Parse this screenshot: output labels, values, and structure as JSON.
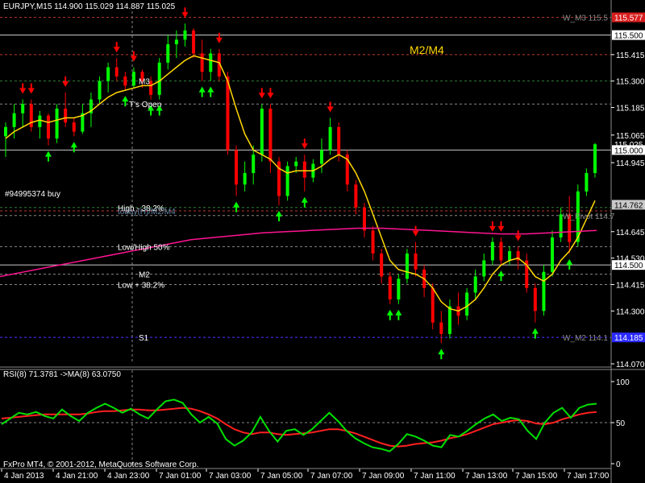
{
  "main_header": "EURJPY,M15  114.900 115.029 114.887 115.025",
  "rsi_header": "RSI(8) 71.3781  ->MA(8) 63.0750",
  "footer": "FxPro MT4, © 2001-2012, MetaQuotes Software Corp.",
  "center_label": "M2/M4",
  "colors": {
    "background": "#000000",
    "bull_candle": "#00ff00",
    "bear_candle": "#ff0000",
    "ma_line": "#ffd700",
    "long_ma_line": "#ff1493",
    "rsi_line": "#00e000",
    "rsi_ma_line": "#ff2020",
    "axis_text": "#ffffff",
    "level_dashed": "#c0392b",
    "level_solid": "#c8c8c8",
    "blue_level": "#2a2aff"
  },
  "price_axis": {
    "ylim": [
      114.07,
      115.6
    ],
    "ticks": [
      "115.415",
      "115.300",
      "115.185",
      "115.065",
      "114.945",
      "114.645",
      "114.530",
      "114.415",
      "114.300",
      "114.070"
    ]
  },
  "price_tags": [
    {
      "value": 115.577,
      "text": "115.577",
      "style": "red"
    },
    {
      "value": 115.5,
      "text": "115.500",
      "style": "white"
    },
    {
      "value": 115.025,
      "text": "115.025",
      "style": "plain"
    },
    {
      "value": 115.0,
      "text": "115.000",
      "style": "white"
    },
    {
      "value": 114.762,
      "text": "114.762",
      "style": "gray"
    },
    {
      "value": 114.5,
      "text": "114.500",
      "style": "white"
    },
    {
      "value": 114.185,
      "text": "114.185",
      "style": "blue"
    }
  ],
  "levels": [
    {
      "value": 115.577,
      "style": "dashed-red",
      "label": "W_M3 115.5",
      "label_side": "right"
    },
    {
      "value": 115.5,
      "style": "solid-gray",
      "label": "",
      "label_side": "right"
    },
    {
      "value": 115.415,
      "style": "dashed-red",
      "label": "",
      "label_side": "right"
    },
    {
      "value": 115.3,
      "style": "dashed-green",
      "label": "M3",
      "label_side": "left"
    },
    {
      "value": 115.2,
      "style": "dashed-gray",
      "label": "T's Open",
      "label_side": "left"
    },
    {
      "value": 115.0,
      "style": "solid-gray",
      "label": "",
      "label_side": "right"
    },
    {
      "value": 114.75,
      "style": "dashed-green",
      "label": "High - 38.2%",
      "label_side": "left"
    },
    {
      "value": 114.735,
      "style": "dashed-red",
      "label": "today(H)/M2/M4",
      "label_side": "left"
    },
    {
      "value": 114.715,
      "style": "dashed-gray",
      "label": "W_Pivot 114.7",
      "label_side": "right"
    },
    {
      "value": 114.58,
      "style": "dashed-gray",
      "label": "Low/High 50%",
      "label_side": "left"
    },
    {
      "value": 114.5,
      "style": "solid-gray",
      "label": "",
      "label_side": "right"
    },
    {
      "value": 114.46,
      "style": "dashed-gray",
      "label": "M2",
      "label_side": "left"
    },
    {
      "value": 114.415,
      "style": "dashed-gray",
      "label": "Low + 38.2%",
      "label_side": "left"
    },
    {
      "value": 114.185,
      "style": "dashed-red",
      "label": "S1",
      "label_side": "left"
    },
    {
      "value": 114.185,
      "style": "dashed-blue",
      "label": "W_M2 114.1",
      "label_side": "right"
    }
  ],
  "trade_label": "#94995374 buy",
  "x_axis_labels": [
    "4 Jan 2013",
    "4 Jan 21:00",
    "4 Jan 23:00",
    "7 Jan 01:00",
    "7 Jan 03:00",
    "7 Jan 05:00",
    "7 Jan 07:00",
    "7 Jan 09:00",
    "7 Jan 11:00",
    "7 Jan 13:00",
    "7 Jan 15:00",
    "7 Jan 17:00"
  ],
  "rsi_axis": {
    "ylim": [
      0,
      100
    ],
    "ticks": [
      "100",
      "50",
      "0"
    ],
    "level": 50
  },
  "chart_data": [
    {
      "type": "candlestick",
      "title": "EURJPY,M15",
      "series": [
        {
          "name": "EURJPY",
          "candles": [
            [
              115.06,
              115.12,
              114.97,
              115.1
            ],
            [
              115.1,
              115.2,
              115.05,
              115.16
            ],
            [
              115.16,
              115.22,
              115.1,
              115.2
            ],
            [
              115.2,
              115.22,
              115.08,
              115.1
            ],
            [
              115.1,
              115.17,
              115.05,
              115.15
            ],
            [
              115.15,
              115.16,
              115.02,
              115.05
            ],
            [
              115.05,
              115.2,
              115.03,
              115.18
            ],
            [
              115.18,
              115.25,
              115.1,
              115.12
            ],
            [
              115.12,
              115.14,
              115.06,
              115.08
            ],
            [
              115.08,
              115.2,
              115.07,
              115.16
            ],
            [
              115.16,
              115.25,
              115.1,
              115.22
            ],
            [
              115.22,
              115.32,
              115.2,
              115.3
            ],
            [
              115.3,
              115.38,
              115.25,
              115.36
            ],
            [
              115.36,
              115.4,
              115.3,
              115.32
            ],
            [
              115.32,
              115.34,
              115.26,
              115.28
            ],
            [
              115.28,
              115.36,
              115.27,
              115.34
            ],
            [
              115.34,
              115.35,
              115.27,
              115.3
            ],
            [
              115.3,
              115.32,
              115.22,
              115.24
            ],
            [
              115.24,
              115.4,
              115.22,
              115.38
            ],
            [
              115.38,
              115.5,
              115.35,
              115.46
            ],
            [
              115.46,
              115.52,
              115.4,
              115.48
            ],
            [
              115.48,
              115.55,
              115.45,
              115.52
            ],
            [
              115.52,
              115.53,
              115.4,
              115.42
            ],
            [
              115.42,
              115.48,
              115.3,
              115.34
            ],
            [
              115.34,
              115.44,
              115.3,
              115.42
            ],
            [
              115.42,
              115.44,
              115.3,
              115.32
            ],
            [
              115.32,
              115.34,
              114.98,
              115.0
            ],
            [
              115.0,
              115.02,
              114.8,
              114.85
            ],
            [
              114.85,
              114.95,
              114.82,
              114.9
            ],
            [
              114.9,
              115.02,
              114.85,
              114.98
            ],
            [
              114.98,
              115.2,
              114.95,
              115.18
            ],
            [
              115.18,
              115.2,
              114.9,
              114.95
            ],
            [
              114.95,
              114.97,
              114.76,
              114.8
            ],
            [
              114.8,
              114.95,
              114.78,
              114.93
            ],
            [
              114.93,
              114.97,
              114.9,
              114.95
            ],
            [
              114.95,
              114.98,
              114.82,
              114.88
            ],
            [
              114.88,
              114.96,
              114.86,
              114.94
            ],
            [
              114.94,
              115.05,
              114.9,
              115.0
            ],
            [
              115.0,
              115.14,
              114.98,
              115.1
            ],
            [
              115.1,
              115.12,
              114.95,
              114.98
            ],
            [
              114.98,
              115.0,
              114.82,
              114.85
            ],
            [
              114.85,
              114.87,
              114.72,
              114.75
            ],
            [
              114.75,
              114.77,
              114.62,
              114.65
            ],
            [
              114.65,
              114.67,
              114.52,
              114.55
            ],
            [
              114.55,
              114.57,
              114.42,
              114.45
            ],
            [
              114.45,
              114.47,
              114.33,
              114.35
            ],
            [
              114.35,
              114.46,
              114.33,
              114.44
            ],
            [
              114.44,
              114.57,
              114.42,
              114.55
            ],
            [
              114.55,
              114.6,
              114.45,
              114.48
            ],
            [
              114.48,
              114.5,
              114.36,
              114.4
            ],
            [
              114.4,
              114.42,
              114.22,
              114.25
            ],
            [
              114.25,
              114.3,
              114.16,
              114.2
            ],
            [
              114.2,
              114.35,
              114.18,
              114.32
            ],
            [
              114.32,
              114.38,
              114.24,
              114.28
            ],
            [
              114.28,
              114.4,
              114.26,
              114.38
            ],
            [
              114.38,
              114.48,
              114.35,
              114.45
            ],
            [
              114.45,
              114.55,
              114.43,
              114.52
            ],
            [
              114.52,
              114.62,
              114.5,
              114.6
            ],
            [
              114.6,
              114.62,
              114.5,
              114.52
            ],
            [
              114.52,
              114.58,
              114.5,
              114.56
            ],
            [
              114.56,
              114.58,
              114.48,
              114.52
            ],
            [
              114.52,
              114.55,
              114.38,
              114.4
            ],
            [
              114.4,
              114.42,
              114.25,
              114.3
            ],
            [
              114.3,
              114.5,
              114.28,
              114.47
            ],
            [
              114.47,
              114.65,
              114.45,
              114.62
            ],
            [
              114.62,
              114.75,
              114.6,
              114.72
            ],
            [
              114.72,
              114.8,
              114.55,
              114.6
            ],
            [
              114.6,
              114.85,
              114.58,
              114.82
            ],
            [
              114.82,
              114.92,
              114.8,
              114.9
            ],
            [
              114.9,
              115.03,
              114.88,
              115.025
            ]
          ]
        },
        {
          "name": "MA",
          "values": [
            115.05,
            115.08,
            115.1,
            115.12,
            115.13,
            115.12,
            115.13,
            115.14,
            115.14,
            115.15,
            115.17,
            115.2,
            115.23,
            115.25,
            115.26,
            115.27,
            115.28,
            115.28,
            115.3,
            115.33,
            115.36,
            115.39,
            115.41,
            115.4,
            115.39,
            115.38,
            115.3,
            115.18,
            115.07,
            115.0,
            114.98,
            114.96,
            114.92,
            114.9,
            114.91,
            114.91,
            114.91,
            114.93,
            114.96,
            114.98,
            114.96,
            114.9,
            114.82,
            114.72,
            114.62,
            114.52,
            114.48,
            114.47,
            114.46,
            114.44,
            114.4,
            114.34,
            114.31,
            114.3,
            114.32,
            114.35,
            114.4,
            114.46,
            114.5,
            114.52,
            114.53,
            114.5,
            114.45,
            114.43,
            114.46,
            114.52,
            114.56,
            114.62,
            114.7,
            114.78
          ]
        },
        {
          "name": "Long MA",
          "values": [
            114.45,
            114.47,
            114.49,
            114.51,
            114.53,
            114.55,
            114.57,
            114.59,
            114.61,
            114.62,
            114.63,
            114.64,
            114.645,
            114.65,
            114.655,
            114.66,
            114.66,
            114.655,
            114.65,
            114.645,
            114.64,
            114.635,
            114.635,
            114.64,
            114.645,
            114.65
          ]
        }
      ]
    },
    {
      "type": "line",
      "title": "RSI(8) 71.3781  ->MA(8) 63.0750",
      "ylim": [
        0,
        100
      ],
      "series": [
        {
          "name": "RSI(8)",
          "values": [
            48,
            55,
            62,
            60,
            63,
            58,
            55,
            66,
            58,
            52,
            62,
            68,
            73,
            68,
            62,
            67,
            60,
            55,
            66,
            76,
            78,
            74,
            60,
            50,
            57,
            49,
            30,
            22,
            28,
            38,
            57,
            40,
            27,
            40,
            42,
            35,
            42,
            52,
            62,
            52,
            40,
            31,
            25,
            20,
            18,
            15,
            24,
            36,
            33,
            28,
            22,
            20,
            35,
            33,
            40,
            48,
            55,
            60,
            52,
            56,
            54,
            40,
            30,
            50,
            62,
            68,
            56,
            68,
            72,
            73
          ]
        },
        {
          "name": "MA(8)",
          "values": [
            55,
            56,
            57,
            58,
            59,
            60,
            60,
            60,
            60,
            60,
            61,
            63,
            64,
            64,
            65,
            66,
            66,
            65,
            65,
            66,
            67,
            68,
            67,
            64,
            60,
            55,
            48,
            42,
            38,
            36,
            38,
            38,
            36,
            35,
            36,
            37,
            38,
            40,
            42,
            42,
            40,
            37,
            33,
            29,
            25,
            22,
            21,
            22,
            24,
            25,
            26,
            28,
            31,
            33,
            36,
            40,
            44,
            48,
            50,
            52,
            53,
            52,
            49,
            48,
            50,
            54,
            57,
            60,
            62,
            63.07
          ]
        }
      ]
    }
  ]
}
